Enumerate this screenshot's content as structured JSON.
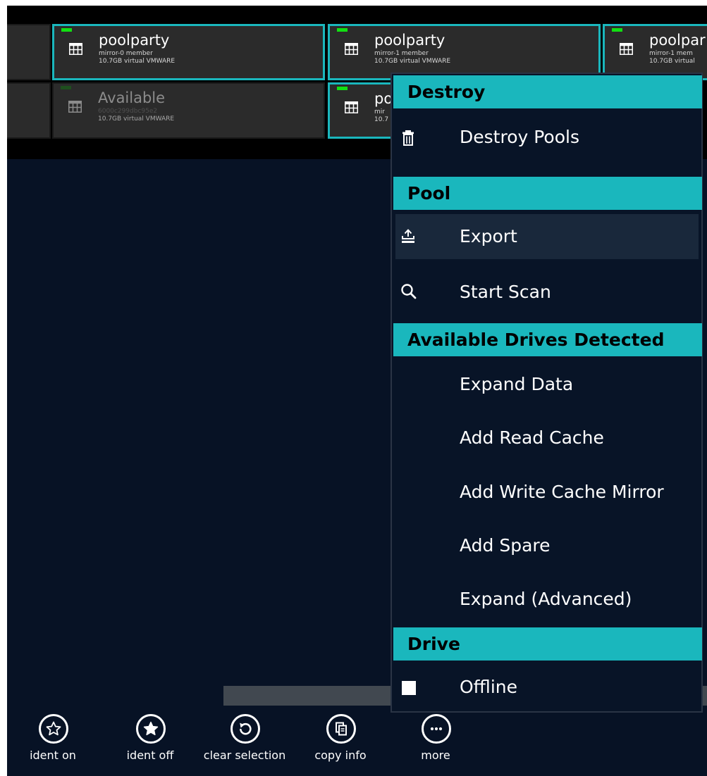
{
  "colors": {
    "accent": "#1ab7bd",
    "background": "#071225",
    "tile_background": "#2b2b2b",
    "status_led": "#12e012"
  },
  "drive_tiles": [
    {
      "name": "poolparty",
      "role": "mirror-0 member",
      "size": "10.7GB virtual VMWARE",
      "state": "active"
    },
    {
      "name": "poolparty",
      "role": "mirror-1 member",
      "size": "10.7GB virtual VMWARE",
      "state": "active"
    },
    {
      "name": "poolpar",
      "role": "mirror-1 mem",
      "size": "10.7GB virtual",
      "state": "active"
    },
    {
      "name": "Available",
      "role": "6000c299dbc95e2",
      "size": "10.7GB virtual VMWARE",
      "state": "available"
    },
    {
      "name": "po",
      "role": "mir",
      "size": "10.7",
      "state": "active"
    }
  ],
  "context_menu": {
    "sections": [
      {
        "header": "Destroy",
        "items": [
          {
            "label": "Destroy Pools",
            "icon": "trash-icon"
          }
        ]
      },
      {
        "header": "Pool",
        "items": [
          {
            "label": "Export",
            "icon": "export-icon",
            "hovered": true
          },
          {
            "label": "Start Scan",
            "icon": "search-icon"
          }
        ]
      },
      {
        "header": "Available Drives Detected",
        "items": [
          {
            "label": "Expand Data"
          },
          {
            "label": "Add Read Cache"
          },
          {
            "label": "Add Write Cache Mirror"
          },
          {
            "label": "Add Spare"
          },
          {
            "label": "Expand (Advanced)"
          }
        ]
      },
      {
        "header": "Drive",
        "items": [
          {
            "label": "Offline",
            "icon": "checkbox-icon"
          }
        ]
      }
    ]
  },
  "app_bar": {
    "buttons": [
      {
        "label": "ident on",
        "icon": "star-outline-icon"
      },
      {
        "label": "ident off",
        "icon": "star-filled-icon"
      },
      {
        "label": "clear selection",
        "icon": "undo-icon"
      },
      {
        "label": "copy info",
        "icon": "copy-icon"
      },
      {
        "label": "more",
        "icon": "more-icon"
      }
    ]
  }
}
